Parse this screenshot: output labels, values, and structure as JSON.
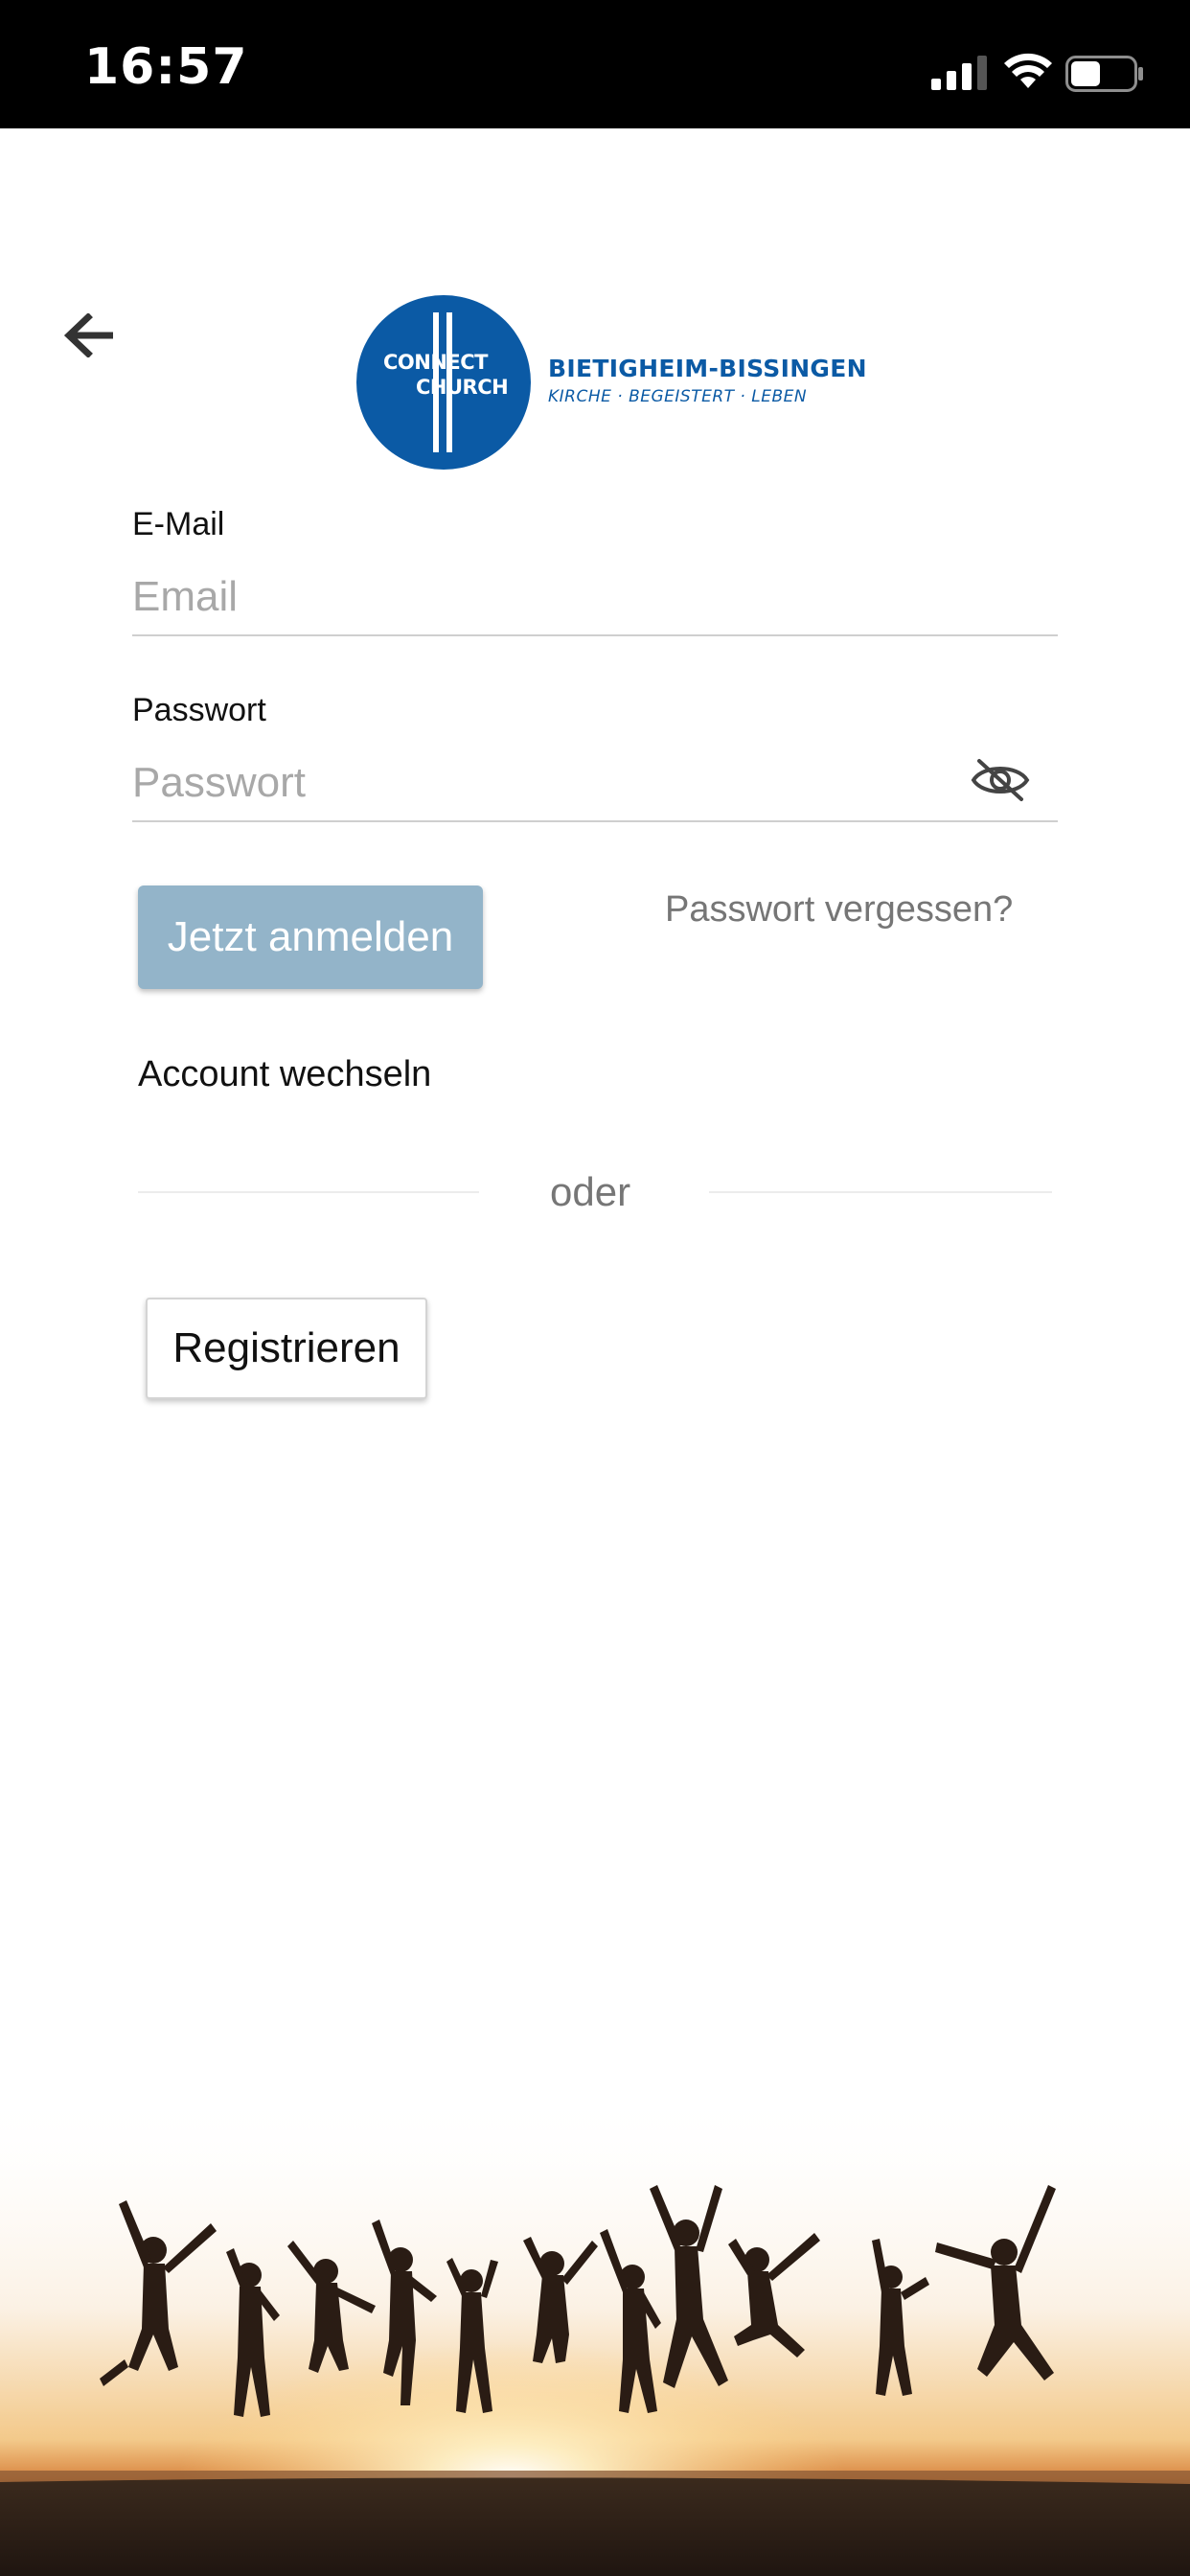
{
  "status_bar": {
    "time": "16:57",
    "icons": [
      "signal-icon",
      "wifi-icon",
      "battery-icon"
    ]
  },
  "header": {
    "back_icon": "arrow-left-icon",
    "logo": {
      "word_top": "CONNECT",
      "word_bottom": "CHURCH",
      "name": "BIETIGHEIM-BISSINGEN",
      "tagline": "KIRCHE · BEGEISTERT · LEBEN"
    }
  },
  "form": {
    "email": {
      "label": "E-Mail",
      "placeholder": "Email",
      "value": ""
    },
    "password": {
      "label": "Passwort",
      "placeholder": "Passwort",
      "value": "",
      "toggle_icon": "eye-slash-icon"
    },
    "login_button": "Jetzt anmelden",
    "forgot_link": "Passwort vergessen?",
    "switch_account": "Account wechseln",
    "divider": "oder",
    "register_button": "Registrieren"
  },
  "colors": {
    "brand_blue": "#0b5aa5",
    "login_button": "#93b4c9",
    "muted_text": "#767676"
  },
  "hero_image": {
    "subject": "silhouettes-jumping-at-sunset"
  }
}
